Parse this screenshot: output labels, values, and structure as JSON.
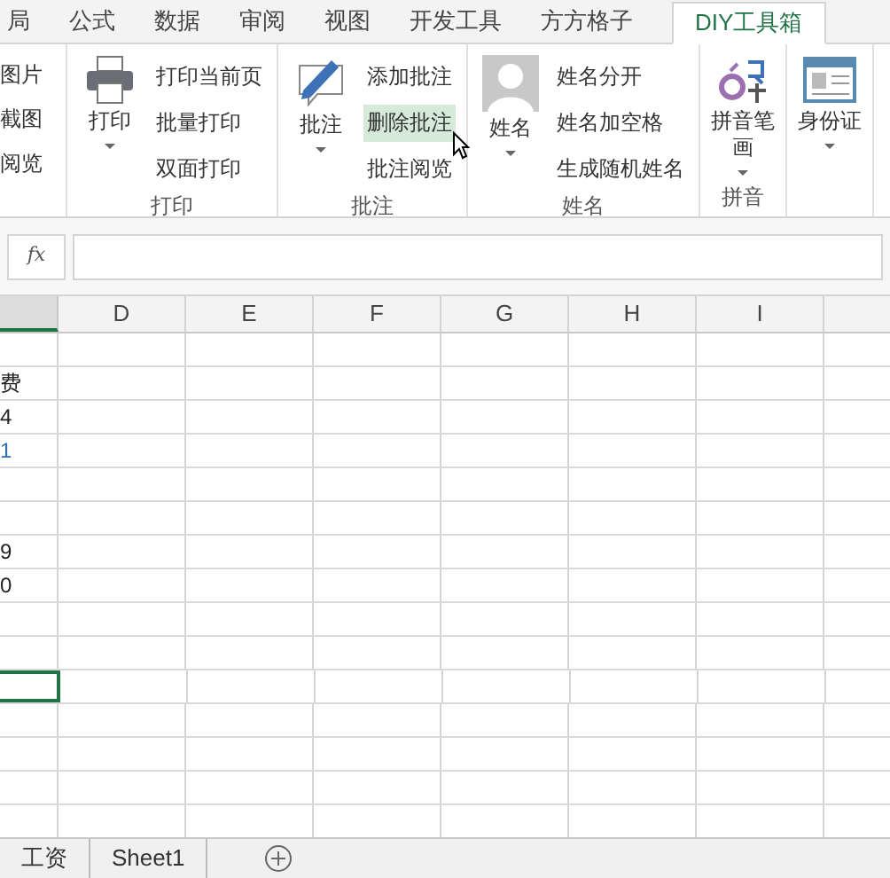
{
  "tabs": [
    {
      "label": "局",
      "selected": false
    },
    {
      "label": "公式",
      "selected": false
    },
    {
      "label": "数据",
      "selected": false
    },
    {
      "label": "审阅",
      "selected": false
    },
    {
      "label": "视图",
      "selected": false
    },
    {
      "label": "开发工具",
      "selected": false
    },
    {
      "label": "方方格子",
      "selected": false
    },
    {
      "label": "DIY工具箱",
      "selected": true
    }
  ],
  "ribbon": {
    "partial_group": {
      "items": [
        "图片",
        "截图",
        "阅览"
      ]
    },
    "groups": [
      {
        "label": "打印",
        "big": {
          "kind": "printer",
          "label": "打印"
        },
        "items": [
          {
            "label": "打印当前页",
            "hovered": false
          },
          {
            "label": "批量打印",
            "hovered": false
          },
          {
            "label": "双面打印",
            "hovered": false
          }
        ]
      },
      {
        "label": "批注",
        "big": {
          "kind": "comment",
          "label": "批注"
        },
        "items": [
          {
            "label": "添加批注",
            "hovered": false
          },
          {
            "label": "删除批注",
            "hovered": true
          },
          {
            "label": "批注阅览",
            "hovered": false
          }
        ]
      },
      {
        "label": "姓名",
        "big": {
          "kind": "avatar",
          "label": "姓名"
        },
        "items": [
          {
            "label": "姓名分开",
            "hovered": false
          },
          {
            "label": "姓名加空格",
            "hovered": false
          },
          {
            "label": "生成随机姓名",
            "hovered": false
          }
        ]
      },
      {
        "label": "拼音",
        "big": {
          "kind": "pinyin",
          "label": "拼音笔画"
        }
      },
      {
        "big": {
          "kind": "idcard",
          "label": "身份证"
        }
      }
    ]
  },
  "formula_bar": {
    "fx": "fx"
  },
  "columns": [
    "D",
    "E",
    "F",
    "G",
    "H",
    "I"
  ],
  "rows": [
    {
      "cell": ""
    },
    {
      "cell": "费",
      "color": "#222222"
    },
    {
      "cell": "4",
      "color": "#222222"
    },
    {
      "cell": "1",
      "color": "#2f6fb5"
    },
    {
      "cell": ""
    },
    {
      "cell": ""
    },
    {
      "cell": "9",
      "color": "#222222"
    },
    {
      "cell": "0",
      "color": "#222222"
    },
    {
      "cell": ""
    },
    {
      "cell": ""
    },
    {
      "cell": "",
      "selected": true
    },
    {
      "cell": ""
    },
    {
      "cell": ""
    },
    {
      "cell": ""
    },
    {
      "cell": ""
    }
  ],
  "sheet_tabs": [
    {
      "label": "工资",
      "selected": false
    },
    {
      "label": "Sheet1",
      "selected": false
    }
  ]
}
